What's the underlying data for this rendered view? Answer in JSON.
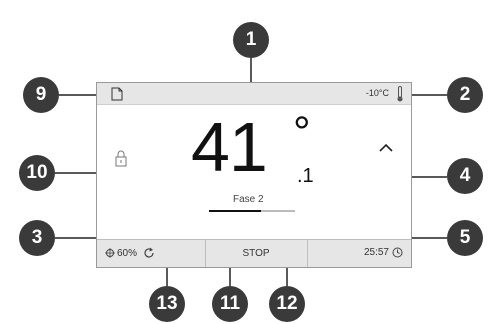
{
  "display": {
    "temperature_main": "41",
    "degree_symbol": "°",
    "temperature_decimal": ".1",
    "phase_label": "Fase 2",
    "progress_fraction": 0.6,
    "external_temperature": "-10°C",
    "humidity": "60%",
    "stop_label": "STOP",
    "time_remaining": "25:57"
  },
  "callouts": [
    "1",
    "2",
    "3",
    "4",
    "5",
    "9",
    "10",
    "11",
    "12",
    "13"
  ],
  "icons": [
    "document-icon",
    "thermometer-icon",
    "lock-icon",
    "chevron-up-icon",
    "humidity-icon",
    "cycle-icon",
    "clock-icon"
  ],
  "colors": {
    "callout_bg": "#3a3a3a",
    "bar_bg": "#e6e6e6"
  }
}
